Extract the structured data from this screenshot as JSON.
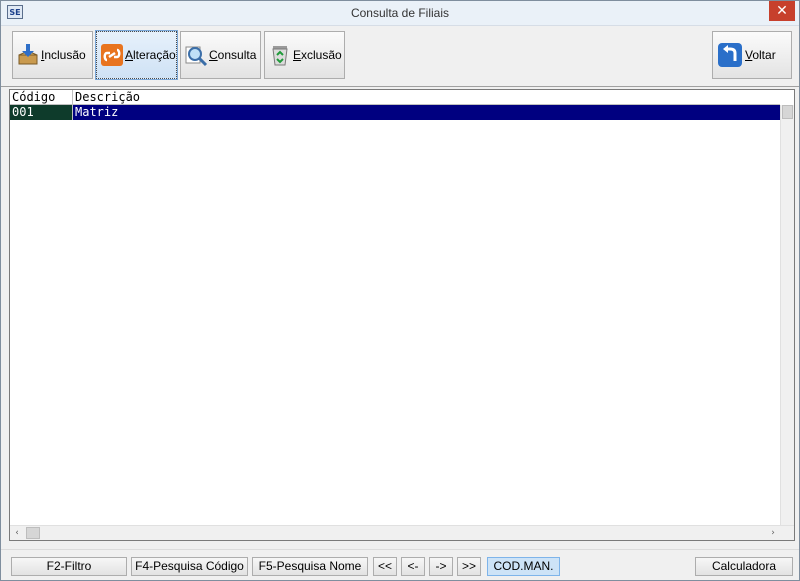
{
  "window": {
    "title": "Consulta  de Filiais",
    "icon_label": "SE",
    "close_glyph": "✕"
  },
  "toolbar": {
    "inclusao": {
      "accel": "I",
      "rest": "nclusão",
      "icon": "box-arrow-down-icon"
    },
    "alteracao": {
      "accel": "A",
      "rest": "lteração",
      "icon": "edit-chain-icon"
    },
    "consulta": {
      "accel": "C",
      "rest": "onsulta",
      "icon": "magnifier-icon"
    },
    "exclusao": {
      "accel": "E",
      "rest": "xclusão",
      "icon": "recycle-bin-icon"
    },
    "voltar": {
      "accel": "V",
      "rest": "oltar",
      "icon": "back-arrow-icon"
    }
  },
  "grid": {
    "columns": [
      "Código",
      "Descrição"
    ],
    "rows": [
      {
        "codigo": "001",
        "descricao": "Matriz"
      }
    ],
    "scroll_left": "‹",
    "scroll_right": "›"
  },
  "statusbar": {
    "f2": "F2-Filtro",
    "f4": "F4-Pesquisa Código",
    "f5": "F5-Pesquisa Nome",
    "first": "<<",
    "prev": "<-",
    "next": "->",
    "last": ">>",
    "codman": "COD.MAN.",
    "calc": "Calculadora"
  },
  "colors": {
    "selected_row": "#000080",
    "selected_code_cell": "#0e3b2b",
    "close_button": "#c7402c"
  }
}
